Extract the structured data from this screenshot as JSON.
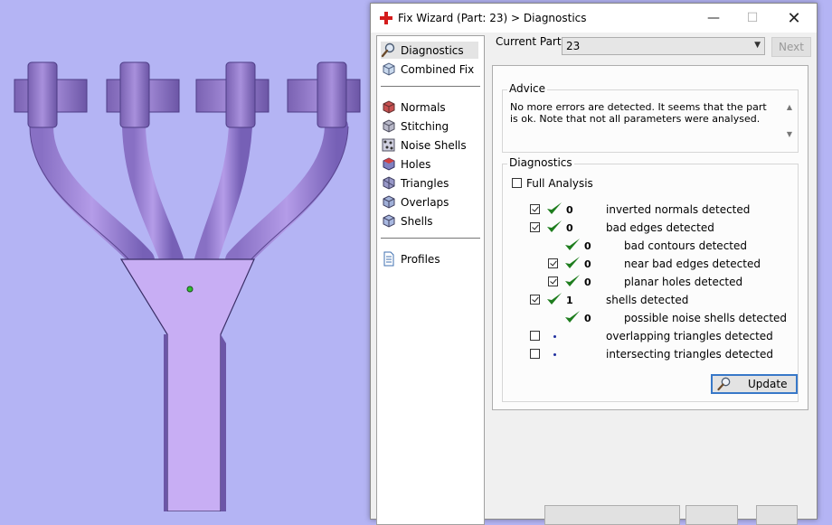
{
  "window": {
    "title": "Fix Wizard (Part: 23) > Diagnostics"
  },
  "nav": {
    "top": [
      {
        "label": "Diagnostics",
        "icon": "magnifier-icon"
      },
      {
        "label": "Combined Fix",
        "icon": "cube-fix-icon"
      }
    ],
    "tools": [
      {
        "label": "Normals",
        "icon": "normals-cube-icon"
      },
      {
        "label": "Stitching",
        "icon": "stitching-cube-icon"
      },
      {
        "label": "Noise Shells",
        "icon": "noise-shells-icon"
      },
      {
        "label": "Holes",
        "icon": "holes-cube-icon"
      },
      {
        "label": "Triangles",
        "icon": "triangles-cube-icon"
      },
      {
        "label": "Overlaps",
        "icon": "overlaps-cube-icon"
      },
      {
        "label": "Shells",
        "icon": "shells-cube-icon"
      }
    ],
    "bottom": [
      {
        "label": "Profiles",
        "icon": "document-icon"
      }
    ]
  },
  "current_part": {
    "label": "Current Part:",
    "value": "23",
    "next_label": "Next"
  },
  "advice": {
    "title": "Advice",
    "text": "No more errors are detected. It seems that the part is ok. Note that not all parameters were analysed."
  },
  "diagnostics": {
    "title": "Diagnostics",
    "full_analysis_label": "Full Analysis",
    "rows": [
      {
        "checkbox": true,
        "checked": true,
        "ok": true,
        "count": "0",
        "label": "inverted normals detected"
      },
      {
        "checkbox": true,
        "checked": true,
        "ok": true,
        "count": "0",
        "label": "bad edges detected"
      },
      {
        "checkbox": false,
        "checked": false,
        "ok": true,
        "count": "0",
        "label": "bad contours detected"
      },
      {
        "checkbox": true,
        "checked": true,
        "ok": true,
        "count": "0",
        "label": "near bad edges detected"
      },
      {
        "checkbox": true,
        "checked": true,
        "ok": true,
        "count": "0",
        "label": "planar holes detected"
      },
      {
        "checkbox": true,
        "checked": true,
        "ok": true,
        "count": "1",
        "label": "shells detected"
      },
      {
        "checkbox": false,
        "checked": false,
        "ok": true,
        "count": "0",
        "label": "possible noise shells detected"
      },
      {
        "checkbox": true,
        "checked": false,
        "ok": false,
        "count": "",
        "label": "overlapping triangles detected"
      },
      {
        "checkbox": true,
        "checked": false,
        "ok": false,
        "count": "",
        "label": "intersecting triangles detected"
      }
    ],
    "update_label": "Update"
  },
  "colors": {
    "viewport_bg": "#b4b4f4",
    "part_fill": "#a48ad8",
    "ok_check": "#1e7d1e",
    "update_border": "#3878c8"
  }
}
